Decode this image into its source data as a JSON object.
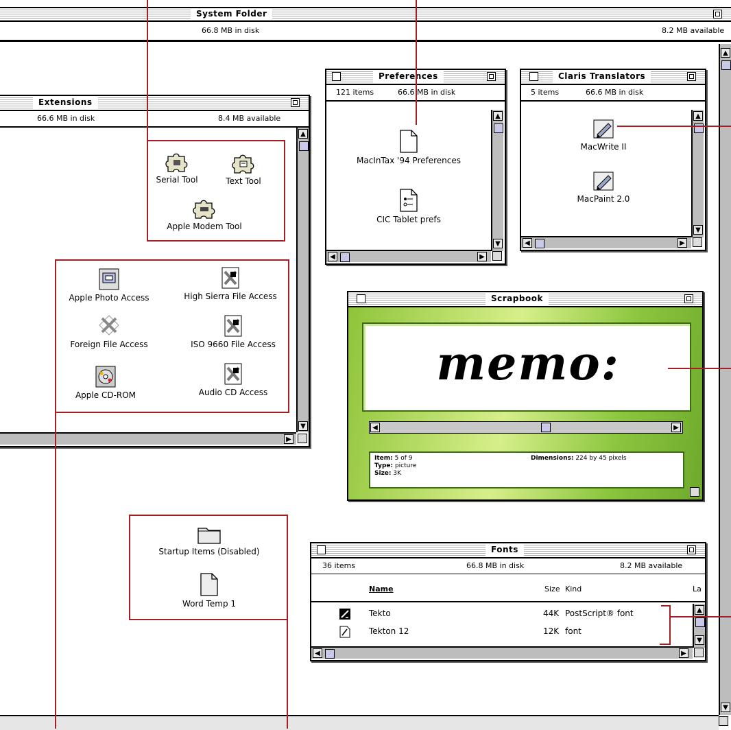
{
  "system_folder": {
    "title": "System Folder",
    "disk_info": "66.8 MB in disk",
    "available": "8.2 MB available"
  },
  "extensions": {
    "title": "Extensions",
    "disk_info": "66.6 MB in disk",
    "available": "8.4 MB available",
    "tools": [
      "Serial Tool",
      "Text Tool",
      "Apple Modem Tool"
    ],
    "access": [
      "Apple Photo Access",
      "High Sierra File Access",
      "Foreign File Access",
      "ISO 9660 File Access",
      "Apple CD-ROM",
      "Audio CD Access"
    ]
  },
  "preferences": {
    "title": "Preferences",
    "items": "121 items",
    "disk_info": "66.6 MB in disk",
    "files": [
      "MacInTax '94 Preferences",
      "CIC Tablet prefs"
    ]
  },
  "claris": {
    "title": "Claris Translators",
    "items": "5 items",
    "disk_info": "66.6 MB in disk",
    "files": [
      "MacWrite II",
      "MacPaint 2.0"
    ]
  },
  "scrapbook": {
    "title": "Scrapbook",
    "picture_text": "memo:",
    "item_label": "Item:",
    "item_value": "5 of 9",
    "type_label": "Type:",
    "type_value": "picture",
    "size_label": "Size:",
    "size_value": "3K",
    "dim_label": "Dimensions:",
    "dim_value": "224 by 45 pixels"
  },
  "loose": {
    "files": [
      "Startup Items (Disabled)",
      "Word Temp 1"
    ]
  },
  "fonts": {
    "title": "Fonts",
    "items": "36 items",
    "disk_info": "66.8 MB in disk",
    "available": "8.2 MB available",
    "headers": {
      "name": "Name",
      "size": "Size",
      "kind": "Kind",
      "la": "La"
    },
    "rows": [
      {
        "name": "Tekto",
        "size": "44K",
        "kind": "PostScript® font"
      },
      {
        "name": "Tekton 12",
        "size": "12K",
        "kind": "font"
      }
    ]
  },
  "colors": {
    "annotation_red": "#a31f24",
    "scrapbook_green": "#8cc63f",
    "scrollbar_gray": "#bdbdbd"
  }
}
